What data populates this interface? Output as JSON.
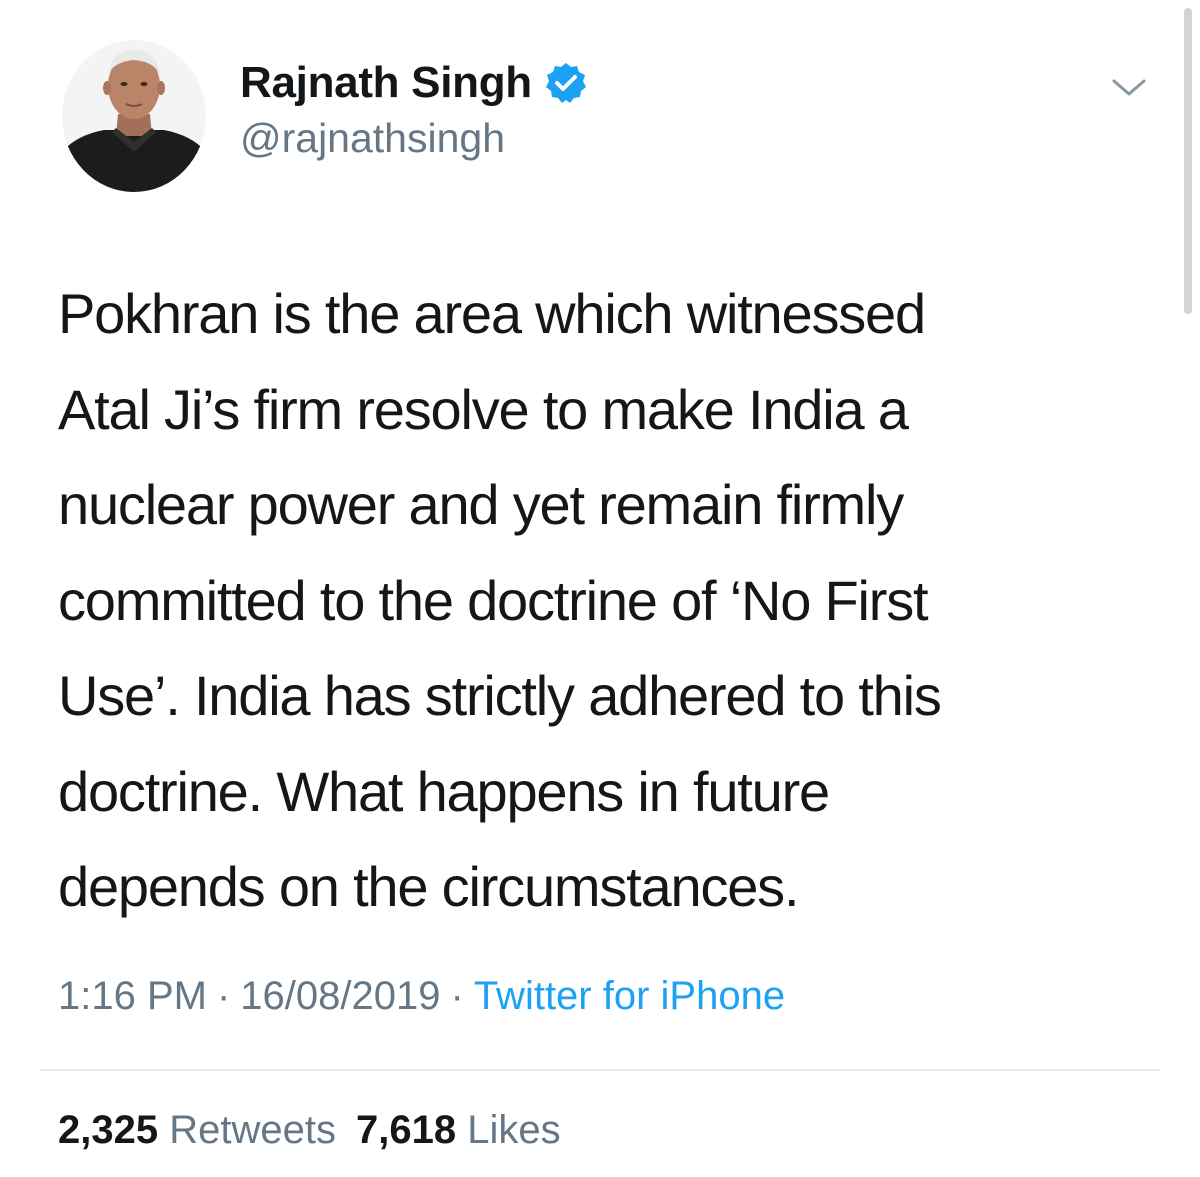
{
  "user": {
    "display_name": "Rajnath Singh",
    "handle": "@rajnathsingh",
    "verified": true,
    "verified_icon": "verified-badge-icon"
  },
  "tweet": {
    "text": "Pokhran is the area which witnessed\nAtal Ji’s firm resolve to make India a\nnuclear power and yet remain firmly\ncommitted to the doctrine of ‘No First\nUse’. India has strictly adhered to this\ndoctrine. What happens in future\ndepends on the circumstances."
  },
  "meta": {
    "time": "1:16 PM",
    "separator": "·",
    "date": "16/08/2019",
    "source": "Twitter for iPhone"
  },
  "stats": {
    "retweets_count": "2,325",
    "retweets_label": "Retweets",
    "likes_count": "7,618",
    "likes_label": "Likes"
  },
  "colors": {
    "text": "#14171a",
    "secondary": "#657786",
    "link": "#1da1f2",
    "divider": "#e6ecf0"
  }
}
